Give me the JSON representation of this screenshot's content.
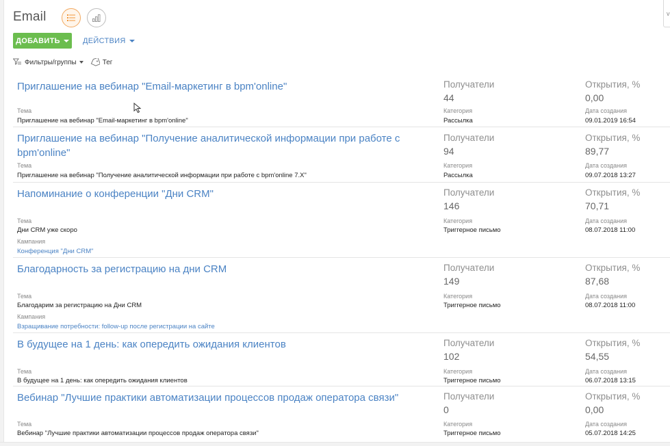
{
  "page": {
    "title": "Email"
  },
  "toolbar": {
    "add_label": "ДОБАВИТЬ",
    "actions_label": "ДЕЙСТВИЯ"
  },
  "filters": {
    "filter_label": "Фильтры/группы",
    "tag_label": "Тег"
  },
  "labels": {
    "subject": "Тема",
    "campaign": "Кампания",
    "recipients": "Получатели",
    "category": "Категория",
    "opens": "Открытия, %",
    "created": "Дата создания"
  },
  "records": [
    {
      "title": "Приглашение на вебинар \"Email-маркетинг в bpm'online\"",
      "subject": "Приглашение на вебинар \"Email-маркетинг в bpm'online\"",
      "recipients": "44",
      "category": "Рассылка",
      "opens": "0,00",
      "created": "09.01.2019 16:54"
    },
    {
      "title": "Приглашение на вебинар \"Получение аналитической информации при работе с bpm'online\"",
      "subject": "Приглашение на вебинар \"Получение аналитической информации при работе с bpm'online 7.X\"",
      "recipients": "94",
      "category": "Рассылка",
      "opens": "89,77",
      "created": "09.07.2018 13:27"
    },
    {
      "title": "Напоминание о конференции \"Дни CRM\"",
      "subject": "Дни CRM уже скоро",
      "campaign": "Конференция \"Дни CRM\"",
      "recipients": "146",
      "category": "Триггерное письмо",
      "opens": "70,71",
      "created": "08.07.2018 11:00"
    },
    {
      "title": "Благодарность за регистрацию на дни CRM",
      "subject": "Благодарим за регистрацию на Дни CRM",
      "campaign": "Взращивание потребности: follow-up после регистрации на сайте",
      "recipients": "149",
      "category": "Триггерное письмо",
      "opens": "87,68",
      "created": "08.07.2018 11:00"
    },
    {
      "title": "В будущее на 1 день: как опередить ожидания клиентов",
      "subject": "В будущее на 1 день: как опередить ожидания клиентов",
      "recipients": "102",
      "category": "Триггерное письмо",
      "opens": "54,55",
      "created": "06.07.2018 13:15"
    },
    {
      "title": "Вебинар \"Лучшие практики автоматизации процессов продаж оператора связи\"",
      "subject": "Вебинар \"Лучшие практики автоматизации процессов продаж оператора связи\"",
      "recipients": "0",
      "category": "Триггерное письмо",
      "opens": "0,00",
      "created": "05.07.2018 14:25"
    }
  ]
}
